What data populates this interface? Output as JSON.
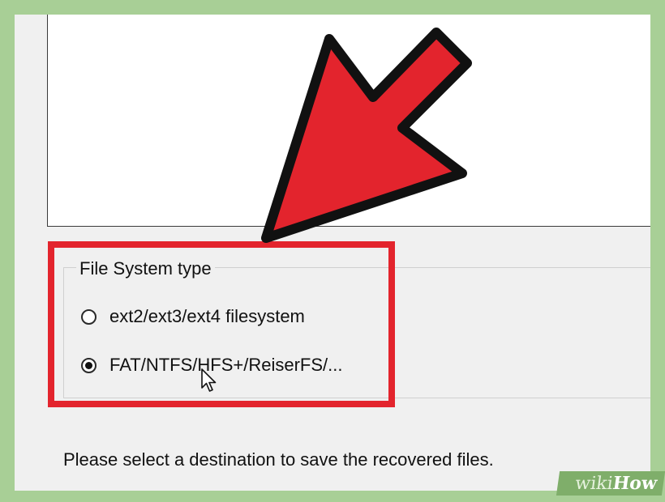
{
  "file_system_type": {
    "title": "File System type",
    "options": [
      {
        "label": "ext2/ext3/ext4 filesystem",
        "selected": false
      },
      {
        "label": "FAT/NTFS/HFS+/ReiserFS/...",
        "selected": true
      }
    ]
  },
  "status_text": "Please select a destination to save the recovered files.",
  "watermark": {
    "wiki": "wiki",
    "how": "How"
  },
  "colors": {
    "highlight": "#e3242d",
    "frame": "#a8cf96"
  }
}
